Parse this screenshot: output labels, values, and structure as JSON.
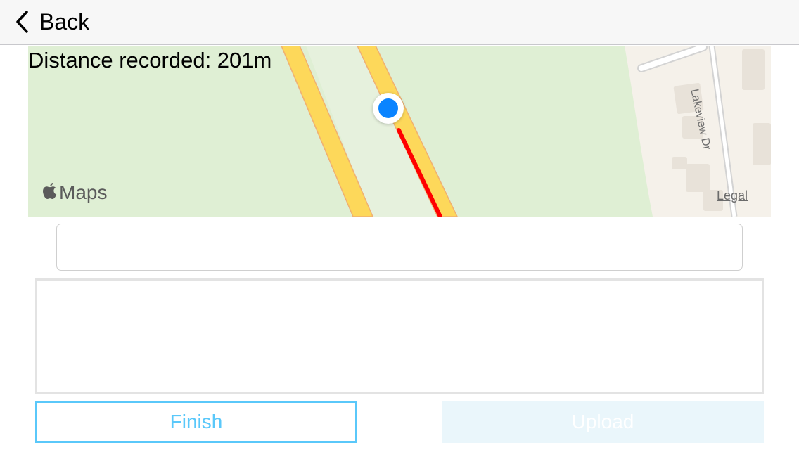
{
  "navbar": {
    "back_label": "Back"
  },
  "map": {
    "distance_text": "Distance recorded: 201m",
    "attribution": "Maps",
    "legal_link": "Legal",
    "street_label": "Lakeview Dr",
    "colors": {
      "park": "#dfefd4",
      "road": "#fdd85a",
      "route": "#ff0000",
      "location": "#0a84ff",
      "residential": "#f5f1ea"
    }
  },
  "form": {
    "title_value": "",
    "notes_value": ""
  },
  "actions": {
    "finish_label": "Finish",
    "upload_label": "Upload",
    "accent_color": "#5ac8fa"
  }
}
